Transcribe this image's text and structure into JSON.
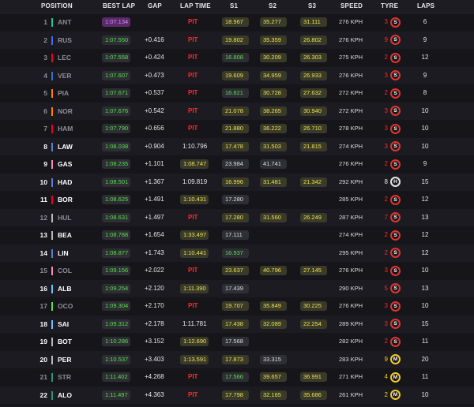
{
  "header": {
    "position": "POSITION",
    "best_lap": "BEST LAP",
    "gap": "GAP",
    "lap_time": "LAP TIME",
    "s1": "S1",
    "s2": "S2",
    "s3": "S3",
    "speed": "SPEED",
    "tyre": "TYRE",
    "laps": "LAPS"
  },
  "colors": {
    "personal_best": "#57e04a",
    "overall_best": "#d38ef0",
    "sector_yellow": "#ece14e",
    "pit": "#ff2b2b",
    "soft": "#e3342f",
    "medium": "#f2cc22",
    "intermediate": "#3bb64a"
  },
  "rows": [
    {
      "pos": "1",
      "team_color": "#27c2a0",
      "driver": "ANT",
      "best": "1:07.134",
      "best_style": "purple",
      "gap": "",
      "lap": "PIT",
      "lap_style": "pit",
      "s1": "18.967",
      "s1_style": "yellow",
      "s2": "35.277",
      "s2_style": "yellow",
      "s3": "31.111",
      "s3_style": "yellow",
      "speed": "276 KPH",
      "stints": "3",
      "tyre": "S",
      "laps": "6",
      "dim": true
    },
    {
      "pos": "2",
      "team_color": "#3a6ff0",
      "driver": "RUS",
      "best": "1:07.550",
      "best_style": "green",
      "gap": "+0.416",
      "lap": "PIT",
      "lap_style": "pit",
      "s1": "19.802",
      "s1_style": "yellow",
      "s2": "35.359",
      "s2_style": "yellow",
      "s3": "26.802",
      "s3_style": "yellow",
      "speed": "276 KPH",
      "stints": "9",
      "tyre": "S",
      "laps": "9",
      "dim": true
    },
    {
      "pos": "3",
      "team_color": "#e8002d",
      "driver": "LEC",
      "best": "1:07.558",
      "best_style": "green",
      "gap": "+0.424",
      "lap": "PIT",
      "lap_style": "pit",
      "s1": "16.808",
      "s1_style": "green",
      "s2": "30.209",
      "s2_style": "yellow",
      "s3": "26.303",
      "s3_style": "yellow",
      "speed": "275 KPH",
      "stints": "2",
      "tyre": "S",
      "laps": "12",
      "dim": true
    },
    {
      "pos": "4",
      "team_color": "#3671c6",
      "driver": "VER",
      "best": "1:07.607",
      "best_style": "green",
      "gap": "+0.473",
      "lap": "PIT",
      "lap_style": "pit",
      "s1": "19.609",
      "s1_style": "yellow",
      "s2": "34.959",
      "s2_style": "yellow",
      "s3": "26.933",
      "s3_style": "yellow",
      "speed": "276 KPH",
      "stints": "3",
      "tyre": "S",
      "laps": "9",
      "dim": true
    },
    {
      "pos": "5",
      "team_color": "#ff8000",
      "driver": "PIA",
      "best": "1:07.671",
      "best_style": "green",
      "gap": "+0.537",
      "lap": "PIT",
      "lap_style": "pit",
      "s1": "16.821",
      "s1_style": "green",
      "s2": "30.728",
      "s2_style": "yellow",
      "s3": "27.632",
      "s3_style": "yellow",
      "speed": "272 KPH",
      "stints": "2",
      "tyre": "S",
      "laps": "8",
      "dim": true
    },
    {
      "pos": "6",
      "team_color": "#ff8000",
      "driver": "NOR",
      "best": "1:07.676",
      "best_style": "green",
      "gap": "+0.542",
      "lap": "PIT",
      "lap_style": "pit",
      "s1": "21.078",
      "s1_style": "yellow",
      "s2": "38.265",
      "s2_style": "yellow",
      "s3": "30.940",
      "s3_style": "yellow",
      "speed": "272 KPH",
      "stints": "3",
      "tyre": "S",
      "laps": "10",
      "dim": true
    },
    {
      "pos": "7",
      "team_color": "#e8002d",
      "driver": "HAM",
      "best": "1:07.790",
      "best_style": "green",
      "gap": "+0.656",
      "lap": "PIT",
      "lap_style": "pit",
      "s1": "21.880",
      "s1_style": "yellow",
      "s2": "36.222",
      "s2_style": "yellow",
      "s3": "26.710",
      "s3_style": "yellow",
      "speed": "278 KPH",
      "stints": "3",
      "tyre": "S",
      "laps": "10",
      "dim": true
    },
    {
      "pos": "8",
      "team_color": "#5a7fd6",
      "driver": "LAW",
      "best": "1:08.038",
      "best_style": "green",
      "gap": "+0.904",
      "lap": "1:10.796",
      "lap_style": "plain",
      "s1": "17.478",
      "s1_style": "yellow",
      "s2": "31.503",
      "s2_style": "yellow",
      "s3": "21.815",
      "s3_style": "yellow",
      "speed": "274 KPH",
      "stints": "3",
      "tyre": "S",
      "laps": "10",
      "dim": false
    },
    {
      "pos": "9",
      "team_color": "#ff87bc",
      "driver": "GAS",
      "best": "1:08.235",
      "best_style": "green",
      "gap": "+1.101",
      "lap": "1:08.747",
      "lap_style": "yellow",
      "s1": "23.984",
      "s1_style": "grey",
      "s2": "41.741",
      "s2_style": "grey",
      "s3": "",
      "s3_style": "none",
      "speed": "276 KPH",
      "stints": "2",
      "tyre": "S",
      "laps": "9",
      "dim": false
    },
    {
      "pos": "10",
      "team_color": "#5a7fd6",
      "driver": "HAD",
      "best": "1:08.501",
      "best_style": "green",
      "gap": "+1.367",
      "lap": "1:09.819",
      "lap_style": "plain",
      "s1": "16.996",
      "s1_style": "yellow",
      "s2": "31.481",
      "s2_style": "yellow",
      "s3": "21.342",
      "s3_style": "yellow",
      "speed": "292 KPH",
      "stints": "8",
      "tyre": "H",
      "laps": "15",
      "dim": false
    },
    {
      "pos": "11",
      "team_color": "#e8002d",
      "driver": "BOR",
      "best": "1:08.625",
      "best_style": "green",
      "gap": "+1.491",
      "lap": "1:10.431",
      "lap_style": "yellow",
      "s1": "17.280",
      "s1_style": "grey",
      "s2": "",
      "s2_style": "none",
      "s3": "",
      "s3_style": "none",
      "speed": "285 KPH",
      "stints": "2",
      "tyre": "S",
      "laps": "12",
      "dim": false
    },
    {
      "pos": "12",
      "team_color": "#b6babd",
      "driver": "HUL",
      "best": "1:08.631",
      "best_style": "green",
      "gap": "+1.497",
      "lap": "PIT",
      "lap_style": "pit",
      "s1": "17.280",
      "s1_style": "yellow",
      "s2": "31.560",
      "s2_style": "yellow",
      "s3": "26.249",
      "s3_style": "yellow",
      "speed": "287 KPH",
      "stints": "7",
      "tyre": "S",
      "laps": "13",
      "dim": true
    },
    {
      "pos": "13",
      "team_color": "#b6babd",
      "driver": "BEA",
      "best": "1:08.788",
      "best_style": "green",
      "gap": "+1.654",
      "lap": "1:33.497",
      "lap_style": "yellow",
      "s1": "17.111",
      "s1_style": "grey",
      "s2": "",
      "s2_style": "none",
      "s3": "",
      "s3_style": "none",
      "speed": "274 KPH",
      "stints": "2",
      "tyre": "S",
      "laps": "12",
      "dim": false
    },
    {
      "pos": "14",
      "team_color": "#5a7fd6",
      "driver": "LIN",
      "best": "1:08.877",
      "best_style": "green",
      "gap": "+1.743",
      "lap": "1:10.441",
      "lap_style": "yellow",
      "s1": "16.937",
      "s1_style": "green",
      "s2": "",
      "s2_style": "none",
      "s3": "",
      "s3_style": "none",
      "speed": "295 KPH",
      "stints": "2",
      "tyre": "S",
      "laps": "12",
      "dim": false
    },
    {
      "pos": "15",
      "team_color": "#ff87bc",
      "driver": "COL",
      "best": "1:09.156",
      "best_style": "green",
      "gap": "+2.022",
      "lap": "PIT",
      "lap_style": "pit",
      "s1": "23.637",
      "s1_style": "yellow",
      "s2": "40.796",
      "s2_style": "yellow",
      "s3": "27.145",
      "s3_style": "yellow",
      "speed": "276 KPH",
      "stints": "3",
      "tyre": "S",
      "laps": "10",
      "dim": true
    },
    {
      "pos": "16",
      "team_color": "#64c4ff",
      "driver": "ALB",
      "best": "1:09.254",
      "best_style": "green",
      "gap": "+2.120",
      "lap": "1:11.390",
      "lap_style": "yellow",
      "s1": "17.439",
      "s1_style": "grey",
      "s2": "",
      "s2_style": "none",
      "s3": "",
      "s3_style": "none",
      "speed": "290 KPH",
      "stints": "5",
      "tyre": "S",
      "laps": "13",
      "dim": false
    },
    {
      "pos": "17",
      "team_color": "#52e252",
      "driver": "OCO",
      "best": "1:09.304",
      "best_style": "green",
      "gap": "+2.170",
      "lap": "PIT",
      "lap_style": "pit",
      "s1": "19.707",
      "s1_style": "yellow",
      "s2": "35.849",
      "s2_style": "yellow",
      "s3": "30.225",
      "s3_style": "yellow",
      "speed": "276 KPH",
      "stints": "3",
      "tyre": "S",
      "laps": "10",
      "dim": true
    },
    {
      "pos": "18",
      "team_color": "#64c4ff",
      "driver": "SAI",
      "best": "1:09.312",
      "best_style": "green",
      "gap": "+2.178",
      "lap": "1:11.781",
      "lap_style": "plain",
      "s1": "17.438",
      "s1_style": "yellow",
      "s2": "32.089",
      "s2_style": "yellow",
      "s3": "22.254",
      "s3_style": "yellow",
      "speed": "289 KPH",
      "stints": "3",
      "tyre": "S",
      "laps": "15",
      "dim": false
    },
    {
      "pos": "19",
      "team_color": "#b6babd",
      "driver": "BOT",
      "best": "1:10.286",
      "best_style": "green",
      "gap": "+3.152",
      "lap": "1:12.690",
      "lap_style": "yellow",
      "s1": "17.568",
      "s1_style": "grey",
      "s2": "",
      "s2_style": "none",
      "s3": "",
      "s3_style": "none",
      "speed": "282 KPH",
      "stints": "2",
      "tyre": "S",
      "laps": "11",
      "dim": false
    },
    {
      "pos": "20",
      "team_color": "#b6babd",
      "driver": "PER",
      "best": "1:10.537",
      "best_style": "green",
      "gap": "+3.403",
      "lap": "1:13.591",
      "lap_style": "yellow",
      "s1": "17.873",
      "s1_style": "yellow",
      "s2": "33.315",
      "s2_style": "grey",
      "s3": "",
      "s3_style": "none",
      "speed": "283 KPH",
      "stints": "9",
      "tyre": "M",
      "laps": "20",
      "dim": false
    },
    {
      "pos": "21",
      "team_color": "#229971",
      "driver": "STR",
      "best": "1:11.402",
      "best_style": "green",
      "gap": "+4.268",
      "lap": "PIT",
      "lap_style": "pit",
      "s1": "17.566",
      "s1_style": "green",
      "s2": "39.657",
      "s2_style": "yellow",
      "s3": "36.991",
      "s3_style": "yellow",
      "speed": "271 KPH",
      "stints": "4",
      "tyre": "M",
      "laps": "11",
      "dim": true
    },
    {
      "pos": "22",
      "team_color": "#229971",
      "driver": "ALO",
      "best": "1:11.497",
      "best_style": "green",
      "gap": "+4.363",
      "lap": "PIT",
      "lap_style": "pit",
      "s1": "17.798",
      "s1_style": "yellow",
      "s2": "32.165",
      "s2_style": "yellow",
      "s3": "35.686",
      "s3_style": "yellow",
      "speed": "261 KPH",
      "stints": "2",
      "tyre": "M",
      "laps": "10",
      "dim": false
    }
  ]
}
